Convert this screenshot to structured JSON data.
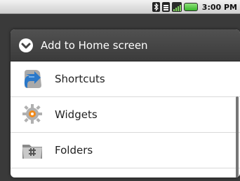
{
  "status_bar": {
    "time": "3:00 PM",
    "icons": [
      "bluetooth-icon",
      "signal-type-icon",
      "signal-bars-icon",
      "battery-icon"
    ]
  },
  "dialog": {
    "title": "Add to Home screen",
    "title_icon": "dropdown-circle-icon",
    "items": [
      {
        "label": "Shortcuts",
        "icon": "shortcut-arrow-icon"
      },
      {
        "label": "Widgets",
        "icon": "widgets-gear-icon"
      },
      {
        "label": "Folders",
        "icon": "folder-icon"
      }
    ]
  },
  "colors": {
    "title_bar": "#444444",
    "battery": "#4bc43c",
    "shortcut_blue": "#2a78c9",
    "widget_orange": "#f08a1c"
  }
}
